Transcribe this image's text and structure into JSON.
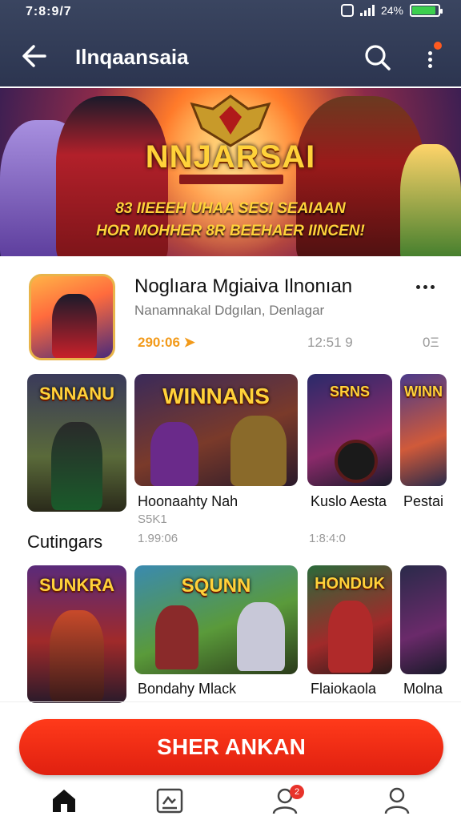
{
  "status": {
    "time": "7:8:9/7",
    "battery": "24%",
    "battery_level": 0.9
  },
  "appbar": {
    "title": "Ilnqaansaia",
    "back_icon": "arrow-left-icon",
    "search_icon": "search-icon",
    "more_icon": "more-vertical-icon"
  },
  "banner": {
    "title": "NNJARSAI",
    "line1": "83 IIEEEH UHAA SESI SEAIAAN",
    "line2": "HOR MOHHER 8R BEEHAER IINCEN!"
  },
  "featured": {
    "name": "Noglıara Mgiaiva Ilnonıan",
    "developer": "Nanamnakal Ddgılan, Denlagar",
    "meta1": "290:06",
    "meta2": "12:51 9",
    "meta3": "0Ξ"
  },
  "row1": [
    {
      "title": "SNNANU",
      "label": "",
      "sub": ""
    },
    {
      "title": "WINNANS",
      "label": "Hoonaahty Nah",
      "sub": "S5K1"
    },
    {
      "title": "SRNS",
      "label": "Kuslo Aesta",
      "sub": ""
    },
    {
      "title": "WINN",
      "label": "Pestai",
      "sub": ""
    }
  ],
  "row1_meta": {
    "left": "1.99:06",
    "right": "1:8:4:0"
  },
  "section": {
    "label": "Cutingars"
  },
  "row2": [
    {
      "title": "SUNKRA",
      "label": "",
      "sub": ""
    },
    {
      "title": "SQUNN",
      "label": "Bondahy Mlack",
      "sub": ""
    },
    {
      "title": "HONDUK",
      "label": "Flaiokaola",
      "sub": ""
    },
    {
      "title": "",
      "label": "Molna",
      "sub": ""
    }
  ],
  "cta": {
    "label": "SHER ANKAN"
  },
  "nav": [
    {
      "icon": "home-icon"
    },
    {
      "icon": "library-icon"
    },
    {
      "icon": "users-icon",
      "badge": "2"
    },
    {
      "icon": "profile-icon"
    }
  ],
  "colors": {
    "accent": "#e8322a",
    "appbar": "#2c3550",
    "gold": "#ffd23a"
  }
}
